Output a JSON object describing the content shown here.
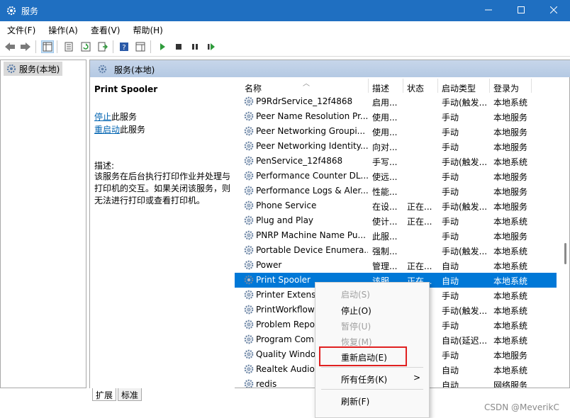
{
  "window": {
    "title": "服务",
    "icons": {
      "app": "gear-icon",
      "minimize": "minimize-icon",
      "maximize": "maximize-icon",
      "close": "close-icon"
    }
  },
  "menu": [
    {
      "label": "文件(F)"
    },
    {
      "label": "操作(A)"
    },
    {
      "label": "查看(V)"
    },
    {
      "label": "帮助(H)"
    }
  ],
  "toolbar": {
    "icons": [
      "back-arrow-icon",
      "forward-arrow-icon",
      "show-console-tree-icon",
      "properties-icon",
      "refresh-icon",
      "export-list-icon",
      "help-icon",
      "show-hide-action-pane-icon",
      "start-service-icon",
      "stop-service-icon",
      "pause-service-icon",
      "restart-service-icon"
    ]
  },
  "tree": {
    "item": "服务(本地)"
  },
  "pane": {
    "header": "服务(本地)",
    "selected_title": "Print Spooler",
    "action_stop_link": "停止",
    "action_stop_suffix": "此服务",
    "action_restart_link": "重启动",
    "action_restart_suffix": "此服务",
    "desc_label": "描述:",
    "desc_text": "该服务在后台执行打印作业并处理与打印机的交互。如果关闭该服务，则无法进行打印或查看打印机。"
  },
  "table": {
    "columns": [
      "名称",
      "描述",
      "状态",
      "启动类型",
      "登录为"
    ],
    "rows": [
      {
        "name": "P9RdrService_12f4868",
        "desc": "启用...",
        "status": "",
        "startup": "手动(触发...",
        "logon": "本地系统"
      },
      {
        "name": "Peer Name Resolution Pr...",
        "desc": "使用...",
        "status": "",
        "startup": "手动",
        "logon": "本地服务"
      },
      {
        "name": "Peer Networking Groupi...",
        "desc": "使用...",
        "status": "",
        "startup": "手动",
        "logon": "本地服务"
      },
      {
        "name": "Peer Networking Identity...",
        "desc": "向对...",
        "status": "",
        "startup": "手动",
        "logon": "本地服务"
      },
      {
        "name": "PenService_12f4868",
        "desc": "手写...",
        "status": "",
        "startup": "手动(触发...",
        "logon": "本地系统"
      },
      {
        "name": "Performance Counter DL...",
        "desc": "使远...",
        "status": "",
        "startup": "手动",
        "logon": "本地服务"
      },
      {
        "name": "Performance Logs & Aler...",
        "desc": "性能...",
        "status": "",
        "startup": "手动",
        "logon": "本地服务"
      },
      {
        "name": "Phone Service",
        "desc": "在设...",
        "status": "正在...",
        "startup": "手动(触发...",
        "logon": "本地服务"
      },
      {
        "name": "Plug and Play",
        "desc": "使计...",
        "status": "正在...",
        "startup": "手动",
        "logon": "本地系统"
      },
      {
        "name": "PNRP Machine Name Pu...",
        "desc": "此服...",
        "status": "",
        "startup": "手动",
        "logon": "本地服务"
      },
      {
        "name": "Portable Device Enumera...",
        "desc": "强制...",
        "status": "",
        "startup": "手动(触发...",
        "logon": "本地系统"
      },
      {
        "name": "Power",
        "desc": "管理...",
        "status": "正在...",
        "startup": "自动",
        "logon": "本地系统"
      },
      {
        "name": "Print Spooler",
        "desc": "该服...",
        "status": "正在...",
        "startup": "自动",
        "logon": "本地系统"
      },
      {
        "name": "Printer Extensi",
        "desc": "",
        "status": "",
        "startup": "手动",
        "logon": "本地系统"
      },
      {
        "name": "PrintWorkflow",
        "desc": "",
        "status": "",
        "startup": "手动(触发...",
        "logon": "本地系统"
      },
      {
        "name": "Problem Repo",
        "desc": "",
        "status": "",
        "startup": "手动",
        "logon": "本地系统"
      },
      {
        "name": "Program Com",
        "desc": "",
        "status": "",
        "startup": "自动(延迟...",
        "logon": "本地系统"
      },
      {
        "name": "Quality Windo",
        "desc": "",
        "status": "",
        "startup": "手动",
        "logon": "本地服务"
      },
      {
        "name": "Realtek Audio",
        "desc": "",
        "status": "",
        "startup": "自动",
        "logon": "本地系统"
      },
      {
        "name": "redis",
        "desc": "",
        "status": "",
        "startup": "自动",
        "logon": "网络服务"
      }
    ],
    "selected_index": 12
  },
  "tabs": [
    {
      "label": "扩展"
    },
    {
      "label": "标准"
    }
  ],
  "context_menu": {
    "items": [
      {
        "label": "启动(S)",
        "disabled": true
      },
      {
        "label": "停止(O)",
        "disabled": false
      },
      {
        "label": "暂停(U)",
        "disabled": true
      },
      {
        "label": "恢复(M)",
        "disabled": true
      },
      {
        "label": "重新启动(E)",
        "disabled": false,
        "highlighted": true
      },
      {
        "label": "所有任务(K)",
        "disabled": false,
        "submenu": ">"
      },
      {
        "label": "刷新(F)",
        "disabled": false
      }
    ]
  },
  "colors": {
    "titlebar": "#1f6fc1",
    "selection": "#0078d7",
    "highlight_box": "#e02020",
    "link": "#0063b1"
  },
  "watermark": "CSDN @MeverikC"
}
